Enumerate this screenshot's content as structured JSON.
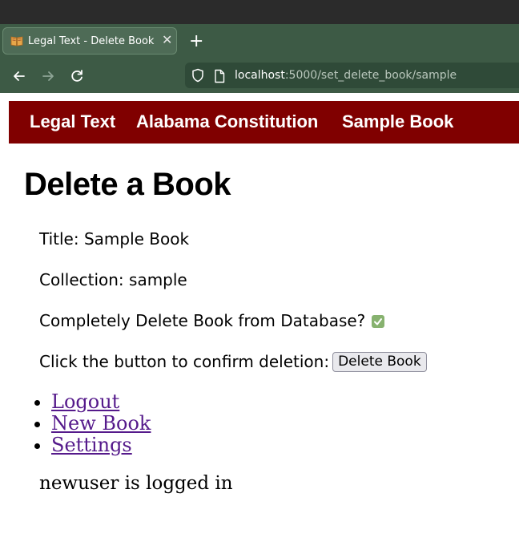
{
  "browser": {
    "tab_title": "Legal Text - Delete Book",
    "url_host": "localhost",
    "url_rest": ":5000/set_delete_book/sample",
    "icons": {
      "favicon": "book-icon",
      "close": "close-icon",
      "new_tab": "plus-icon",
      "back": "back-arrow-icon",
      "forward": "forward-arrow-icon",
      "reload": "reload-icon",
      "shield": "shield-icon",
      "page": "page-icon"
    }
  },
  "site_nav": {
    "items": [
      "Legal Text",
      "Alabama Constitution",
      "Sample Book"
    ],
    "background": "#800000"
  },
  "page": {
    "title": "Delete a Book",
    "title_label": "Title: Sample Book",
    "collection_label": "Collection: sample",
    "delete_question": "Completely Delete Book from Database?",
    "delete_checked": true,
    "confirm_text": "Click the button to confirm deletion:",
    "delete_button": "Delete Book",
    "links": [
      "Logout",
      "New Book",
      "Settings"
    ],
    "status": "newuser is logged in"
  },
  "colors": {
    "link": "#551a8b",
    "checkbox": "#87b26f",
    "chrome": "#3d5a45"
  }
}
